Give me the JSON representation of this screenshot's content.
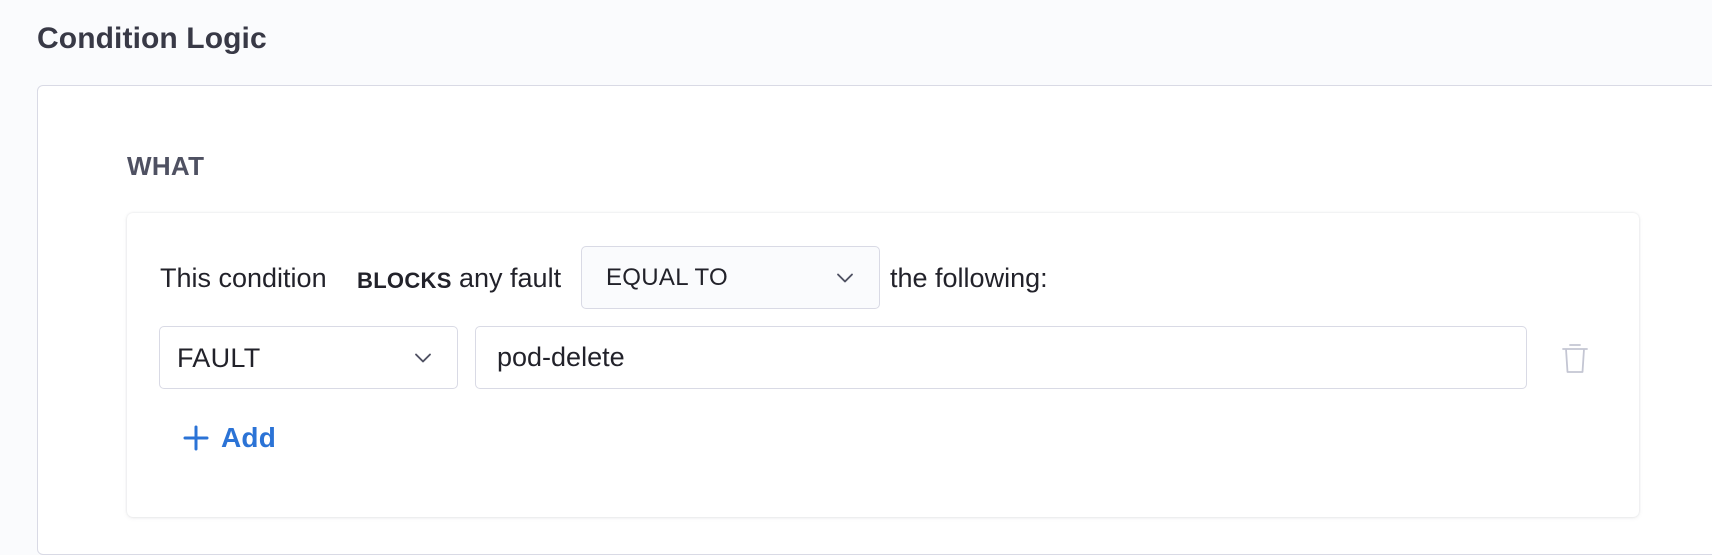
{
  "section": {
    "title": "Condition Logic"
  },
  "what": {
    "label": "WHAT"
  },
  "condition": {
    "prefix": "This condition",
    "mode": "BLOCKS",
    "middle": "any fault",
    "operator": {
      "selected": "EQUAL TO"
    },
    "suffix": "the following:"
  },
  "rule": {
    "field": {
      "selected": "FAULT"
    },
    "value": "pod-delete"
  },
  "actions": {
    "add_label": "Add"
  },
  "icons": {
    "operator_chevron": "chevron-down-icon",
    "field_chevron": "chevron-down-icon",
    "delete": "trash-icon",
    "add": "plus-icon"
  },
  "colors": {
    "accent": "#2b73d6",
    "border": "#d9dae5",
    "text": "#22222a",
    "muted_icon": "#c4c6d3"
  }
}
